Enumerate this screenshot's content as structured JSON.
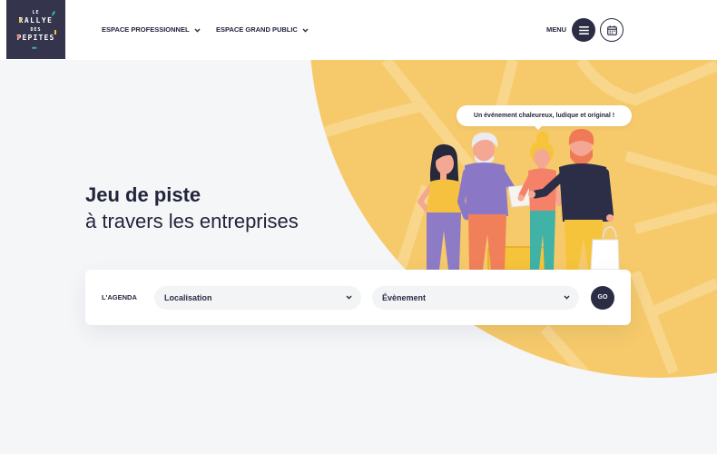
{
  "logo": {
    "lines": [
      "LE",
      "RALLYE",
      "DES",
      "PEPITES"
    ]
  },
  "nav": {
    "items": [
      {
        "label": "ESPACE PROFESSIONNEL",
        "icon": "chevron-down-icon"
      },
      {
        "label": "ESPACE GRAND PUBLIC",
        "icon": "chevron-down-icon"
      }
    ]
  },
  "header_actions": {
    "menu_label": "MENU",
    "menu_icon": "menu-icon",
    "calendar_icon": "calendar-icon"
  },
  "hero": {
    "title": "Jeu de piste",
    "subtitle": "à travers les entreprises",
    "speech_bubble": "Un événement chaleureux, ludique et original !"
  },
  "search": {
    "label": "L'AGENDA",
    "location_select": {
      "value": "Localisation",
      "icon": "chevron-down-icon"
    },
    "event_select": {
      "value": "Évènement",
      "icon": "chevron-down-icon"
    },
    "submit_label": "GO"
  },
  "colors": {
    "navy": "#2b2d44",
    "accent_yellow": "#f6ca6b",
    "background": "#f5f6f8",
    "card": "#ffffff"
  }
}
